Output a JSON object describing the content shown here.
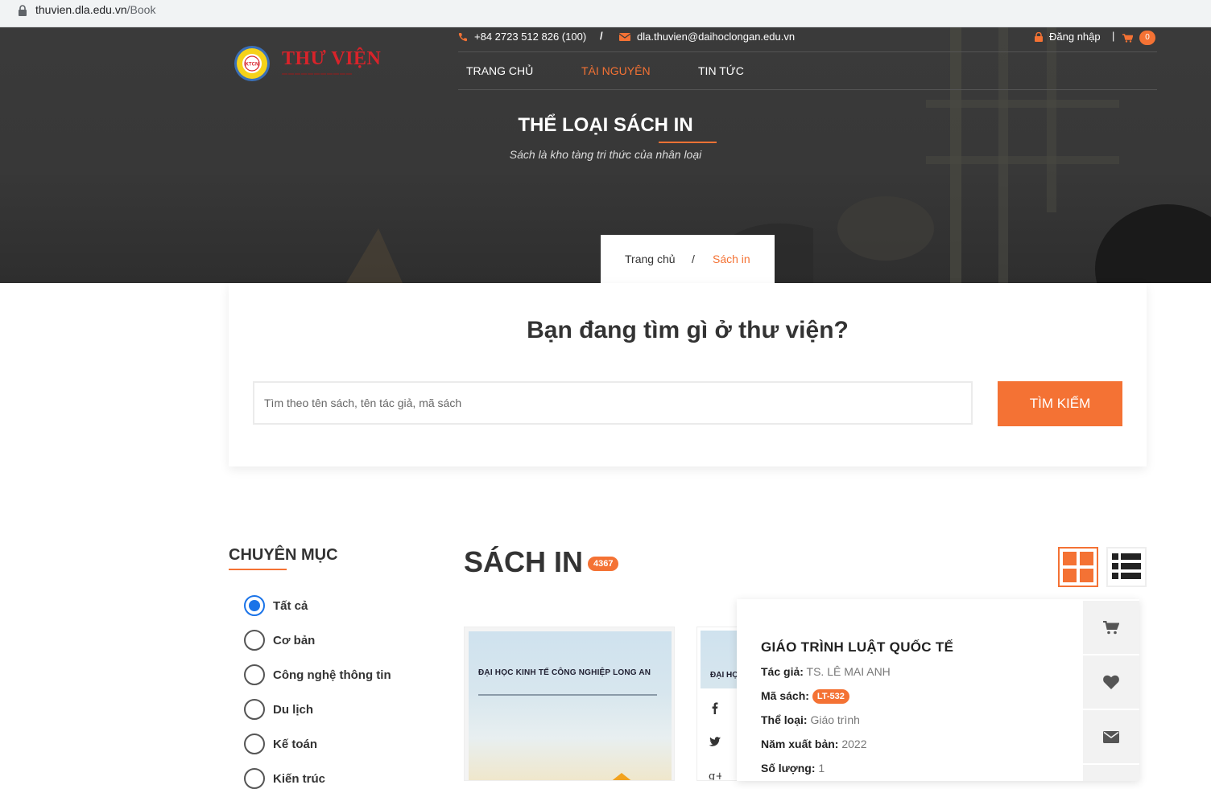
{
  "browser": {
    "url_host": "thuvien.dla.edu.vn",
    "url_path": "/Book"
  },
  "header": {
    "logo_text": "THƯ VIỆN",
    "logo_emblem_text": "KTCN",
    "phone": "+84 2723 512 826 (100)",
    "separator": "/",
    "email": "dla.thuvien@daihoclongan.edu.vn",
    "login": "Đăng nhập",
    "divider": "|",
    "cart_count": "0",
    "nav": [
      {
        "label": "TRANG CHỦ"
      },
      {
        "label": "TÀI NGUYÊN",
        "active": true
      },
      {
        "label": "TIN TỨC"
      }
    ]
  },
  "hero": {
    "title": "THỂ LOẠI SÁCH IN",
    "subtitle": "Sách là kho tàng tri thức của nhân loại",
    "breadcrumb": {
      "home": "Trang chủ",
      "sep": "/",
      "current": "Sách in"
    }
  },
  "search": {
    "heading": "Bạn đang tìm gì ở thư viện?",
    "placeholder": "Tìm theo tên sách, tên tác giả, mã sách",
    "button": "TÌM KIẾM"
  },
  "sidebar": {
    "title": "CHUYÊN MỤC",
    "categories": [
      {
        "label": "Tất cả",
        "checked": true
      },
      {
        "label": "Cơ bản"
      },
      {
        "label": "Công nghệ thông tin"
      },
      {
        "label": "Du lịch"
      },
      {
        "label": "Kế toán"
      },
      {
        "label": "Kiến trúc"
      }
    ]
  },
  "main": {
    "title": "SÁCH IN",
    "count": "4367",
    "book_cover_text": "ĐẠI HỌC KINH TẾ CÔNG NGHIỆP LONG AN",
    "book_cover_text_partial": "ĐẠI HỌ",
    "detail": {
      "title": "GIÁO TRÌNH LUẬT QUỐC TẾ",
      "author_label": "Tác giả:",
      "author": "TS. LÊ MAI ANH",
      "code_label": "Mã sách:",
      "code": "LT-532",
      "genre_label": "Thể loại:",
      "genre": "Giáo trình",
      "year_label": "Năm xuất bản:",
      "year": "2022",
      "qty_label": "Số lượng:",
      "qty": "1"
    }
  },
  "colors": {
    "accent": "#f47234",
    "hero_bg": "#383838",
    "radio_checked": "#1a73e8"
  },
  "icons": [
    "lock-icon",
    "phone-icon",
    "mail-icon",
    "padlock-icon",
    "cart-icon",
    "grid-view-icon",
    "list-view-icon",
    "facebook-icon",
    "twitter-icon",
    "google-plus-icon",
    "heart-icon",
    "envelope-icon"
  ]
}
